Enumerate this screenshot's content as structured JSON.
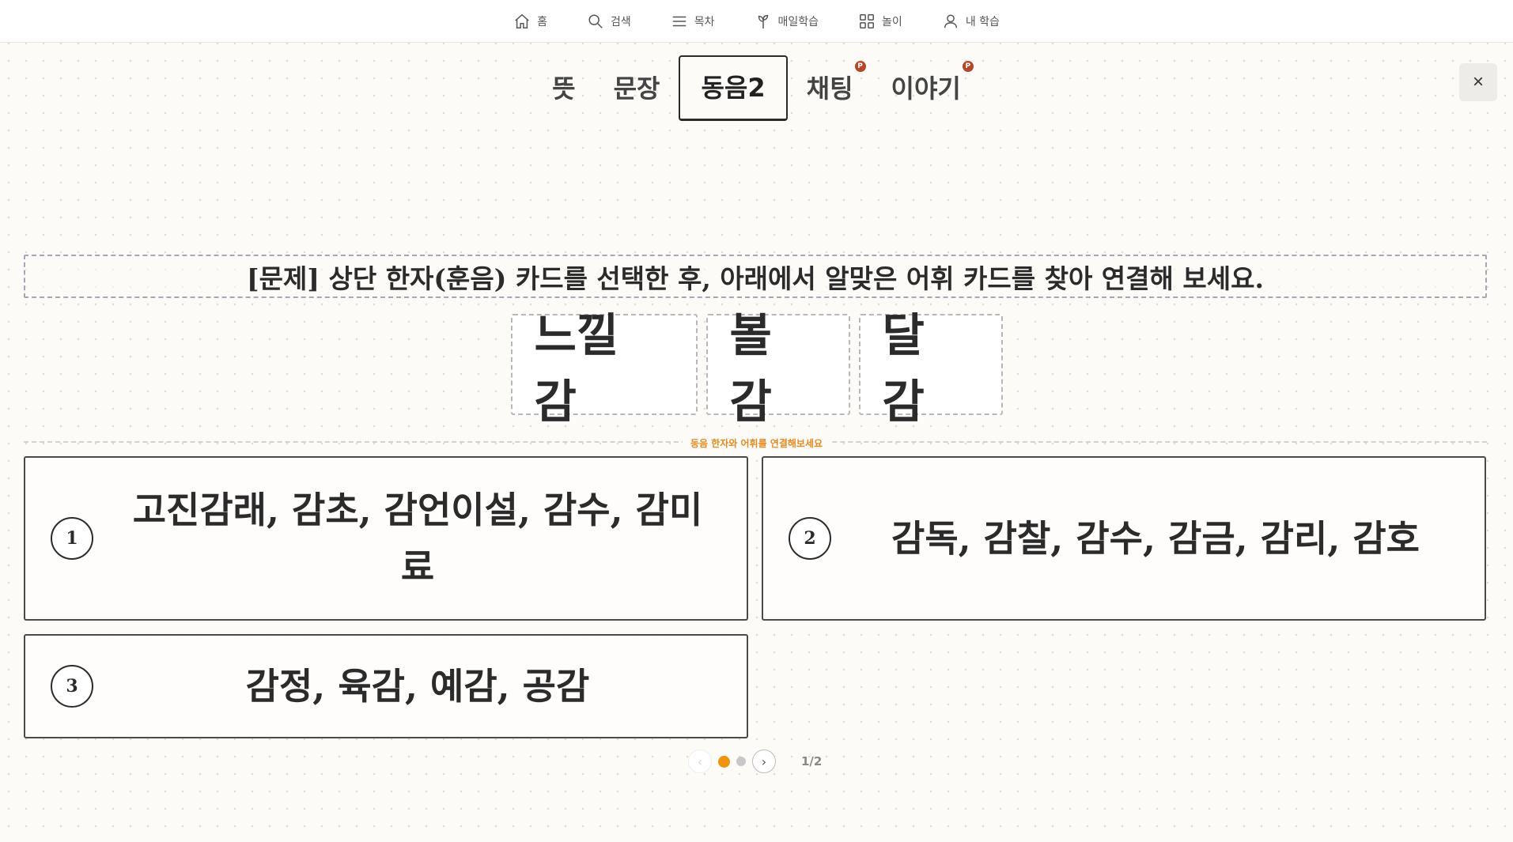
{
  "nav": {
    "items": [
      {
        "label": "홈",
        "icon": "home-icon"
      },
      {
        "label": "검색",
        "icon": "search-icon"
      },
      {
        "label": "목차",
        "icon": "menu-icon"
      },
      {
        "label": "매일학습",
        "icon": "sprout-icon"
      },
      {
        "label": "놀이",
        "icon": "grid-icon"
      },
      {
        "label": "내 학습",
        "icon": "user-icon"
      }
    ]
  },
  "tabs": [
    {
      "label": "뜻",
      "active": false,
      "badge": ""
    },
    {
      "label": "문장",
      "active": false,
      "badge": ""
    },
    {
      "label": "동음2",
      "active": true,
      "badge": ""
    },
    {
      "label": "채팅",
      "active": false,
      "badge": "P"
    },
    {
      "label": "이야기",
      "active": false,
      "badge": "P"
    }
  ],
  "close_label": "×",
  "instruction": "[문제] 상단 한자(훈음) 카드를 선택한 후, 아래에서 알맞은 어휘 카드를 찾아 연결해 보세요.",
  "hanja_cards": [
    "느낄 감",
    "볼 감",
    "달 감"
  ],
  "divider_label": "동음 한자와 어휘를 연결해보세요",
  "answers": [
    {
      "num": "1",
      "words": "고진감래, 감초, 감언이설, 감수, 감미료"
    },
    {
      "num": "2",
      "words": "감독, 감찰, 감수, 감금, 감리, 감호"
    },
    {
      "num": "3",
      "words": "감정, 육감, 예감, 공감"
    }
  ],
  "pager": {
    "prev": "‹",
    "next": "›",
    "count": "1/2",
    "current_page": 1,
    "total_pages": 2
  },
  "colors": {
    "accent": "#f0940f",
    "badge": "#b5462a",
    "label": "#e68a22"
  }
}
